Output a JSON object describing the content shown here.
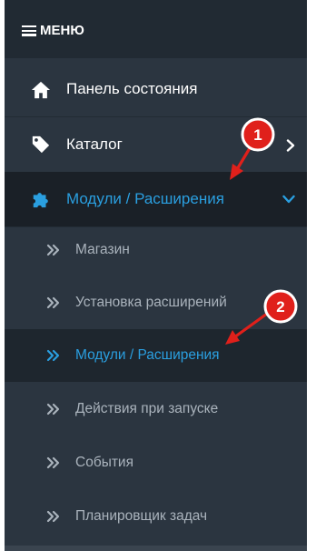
{
  "menu": {
    "header_label": "МЕНЮ",
    "items": [
      {
        "label": "Панель состояния",
        "icon": "home-icon"
      },
      {
        "label": "Каталог",
        "icon": "tag-icon"
      },
      {
        "label": "Модули / Расширения",
        "icon": "puzzle-icon",
        "active": true
      }
    ],
    "submenu": [
      {
        "label": "Магазин"
      },
      {
        "label": "Установка расширений"
      },
      {
        "label": "Модули / Расширения",
        "active": true
      },
      {
        "label": "Действия при запуске"
      },
      {
        "label": "События"
      },
      {
        "label": "Планировщик задач"
      }
    ]
  },
  "annotations": [
    {
      "number": "1"
    },
    {
      "number": "2"
    }
  ],
  "colors": {
    "sidebar_bg": "#2b3540",
    "header_bg": "#212a33",
    "active_text": "#2a9fe0",
    "callout_red": "#e0201b"
  }
}
